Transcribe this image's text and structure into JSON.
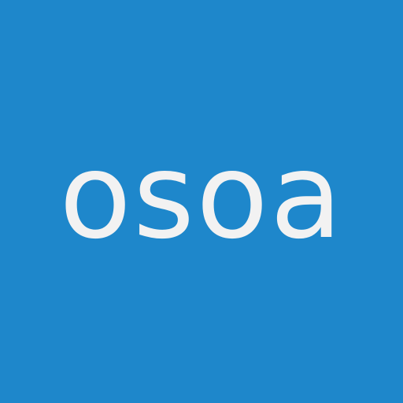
{
  "logo": {
    "text": "osoa",
    "background_color": "#1E87CB",
    "text_color": "#F2F2F2"
  }
}
